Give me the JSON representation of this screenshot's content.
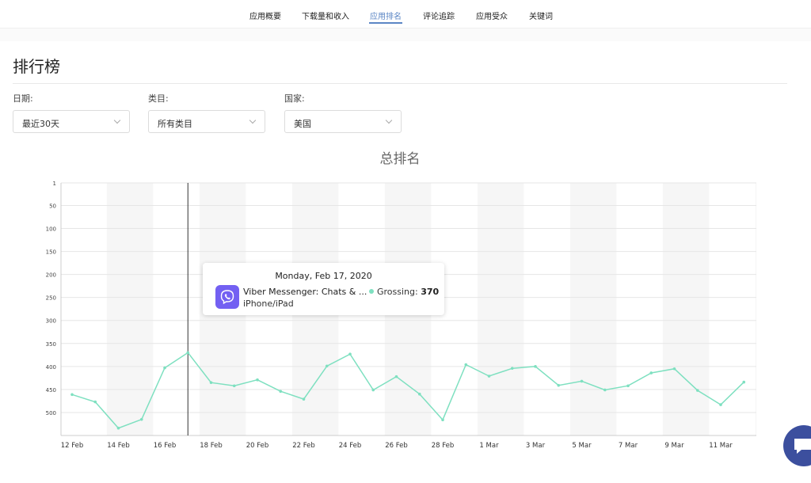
{
  "nav": {
    "items": [
      {
        "label": "应用概要"
      },
      {
        "label": "下载量和收入"
      },
      {
        "label": "应用排名"
      },
      {
        "label": "评论追踪"
      },
      {
        "label": "应用受众"
      },
      {
        "label": "关键词"
      }
    ],
    "active_index": 2
  },
  "page": {
    "title": "排行榜"
  },
  "filters": [
    {
      "label": "日期:",
      "value": "最近30天"
    },
    {
      "label": "类目:",
      "value": "所有类目"
    },
    {
      "label": "国家:",
      "value": "美国"
    }
  ],
  "tooltip": {
    "date": "Monday, Feb 17, 2020",
    "app_name": "Viber Messenger: Chats & ...",
    "device": "iPhone/iPad",
    "metric_label": "Grossing:",
    "metric_value": "370",
    "app_icon_color": "#7360f2"
  },
  "chart_data": {
    "type": "line",
    "title": "总排名",
    "y_axis": {
      "reversed": true,
      "ylim": [
        1,
        550
      ],
      "ticks": [
        1,
        50,
        100,
        150,
        200,
        250,
        300,
        350,
        400,
        450,
        500
      ]
    },
    "x_tick_labels": [
      "12 Feb",
      "14 Feb",
      "16 Feb",
      "18 Feb",
      "20 Feb",
      "22 Feb",
      "24 Feb",
      "26 Feb",
      "28 Feb",
      "1 Mar",
      "3 Mar",
      "5 Mar",
      "7 Mar",
      "9 Mar",
      "11 Mar"
    ],
    "x": [
      "12 Feb",
      "13 Feb",
      "14 Feb",
      "15 Feb",
      "16 Feb",
      "17 Feb",
      "18 Feb",
      "19 Feb",
      "20 Feb",
      "21 Feb",
      "22 Feb",
      "23 Feb",
      "24 Feb",
      "25 Feb",
      "26 Feb",
      "27 Feb",
      "28 Feb",
      "29 Feb",
      "1 Mar",
      "2 Mar",
      "3 Mar",
      "4 Mar",
      "5 Mar",
      "6 Mar",
      "7 Mar",
      "8 Mar",
      "9 Mar",
      "10 Mar",
      "11 Mar",
      "12 Mar"
    ],
    "series": [
      {
        "values": [
          461,
          477,
          534,
          515,
          403,
          370,
          435,
          442,
          429,
          454,
          471,
          399,
          373,
          451,
          422,
          460,
          516,
          396,
          421,
          404,
          400,
          441,
          432,
          451,
          442,
          414,
          405,
          452,
          483,
          434
        ],
        "color": "#7ee0c0"
      }
    ],
    "highlight_x": "17 Feb",
    "grid": true,
    "alt_bands": true,
    "legend": "none"
  },
  "chat": {
    "icon": "chat-bubble-icon"
  }
}
